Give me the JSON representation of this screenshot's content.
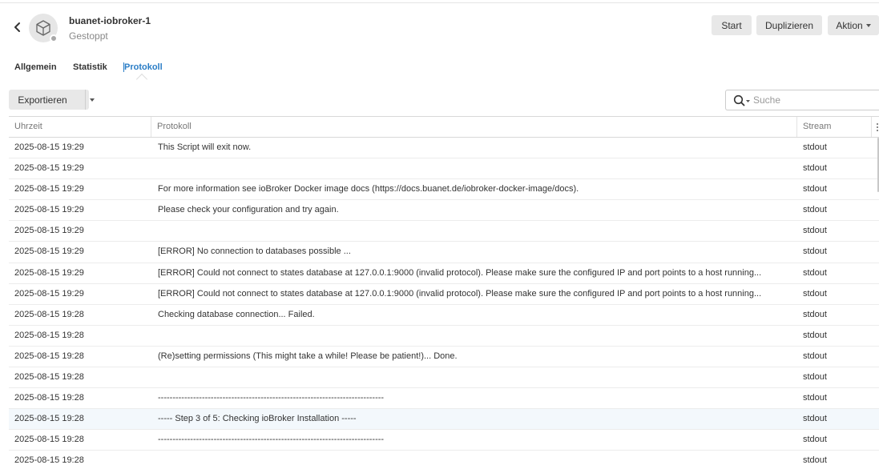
{
  "header": {
    "app_name": "buanet-iobroker-1",
    "app_status": "Gestoppt"
  },
  "actions": {
    "start": "Start",
    "duplicate": "Duplizieren",
    "action": "Aktion"
  },
  "tabs": [
    {
      "label": "Allgemein"
    },
    {
      "label": "Statistik"
    },
    {
      "label": "Protokoll"
    }
  ],
  "toolbar": {
    "export": "Exportieren",
    "search_placeholder": "Suche"
  },
  "table": {
    "columns": [
      "Uhrzeit",
      "Protokoll",
      "Stream"
    ],
    "rows": [
      {
        "time": "2025-08-15 19:29",
        "log": "This Script will exit now.",
        "stream": "stdout"
      },
      {
        "time": "2025-08-15 19:29",
        "log": "",
        "stream": "stdout"
      },
      {
        "time": "2025-08-15 19:29",
        "log": "For more information see ioBroker Docker image docs (https://docs.buanet.de/iobroker-docker-image/docs).",
        "stream": "stdout"
      },
      {
        "time": "2025-08-15 19:29",
        "log": "Please check your configuration and try again.",
        "stream": "stdout"
      },
      {
        "time": "2025-08-15 19:29",
        "log": "",
        "stream": "stdout"
      },
      {
        "time": "2025-08-15 19:29",
        "log": "[ERROR] No connection to databases possible ...",
        "stream": "stdout"
      },
      {
        "time": "2025-08-15 19:29",
        "log": "[ERROR] Could not connect to states database at 127.0.0.1:9000 (invalid protocol). Please make sure the configured IP and port points to a host running...",
        "stream": "stdout"
      },
      {
        "time": "2025-08-15 19:29",
        "log": "[ERROR] Could not connect to states database at 127.0.0.1:9000 (invalid protocol). Please make sure the configured IP and port points to a host running...",
        "stream": "stdout"
      },
      {
        "time": "2025-08-15 19:28",
        "log": "Checking database connection... Failed.",
        "stream": "stdout"
      },
      {
        "time": "2025-08-15 19:28",
        "log": "",
        "stream": "stdout"
      },
      {
        "time": "2025-08-15 19:28",
        "log": "(Re)setting permissions (This might take a while! Please be patient!)... Done.",
        "stream": "stdout"
      },
      {
        "time": "2025-08-15 19:28",
        "log": "",
        "stream": "stdout"
      },
      {
        "time": "2025-08-15 19:28",
        "log": "-----------------------------------------------------------------------------",
        "stream": "stdout"
      },
      {
        "time": "2025-08-15 19:28",
        "log": "----- Step 3 of 5: Checking ioBroker Installation -----",
        "stream": "stdout",
        "highlight": true
      },
      {
        "time": "2025-08-15 19:28",
        "log": "-----------------------------------------------------------------------------",
        "stream": "stdout"
      },
      {
        "time": "2025-08-15 19:28",
        "log": "",
        "stream": "stdout"
      }
    ]
  },
  "colors": {
    "accent": "#2a7dc6",
    "button_bg": "#e8e8e8",
    "status_stopped": "#a8a8a8"
  }
}
